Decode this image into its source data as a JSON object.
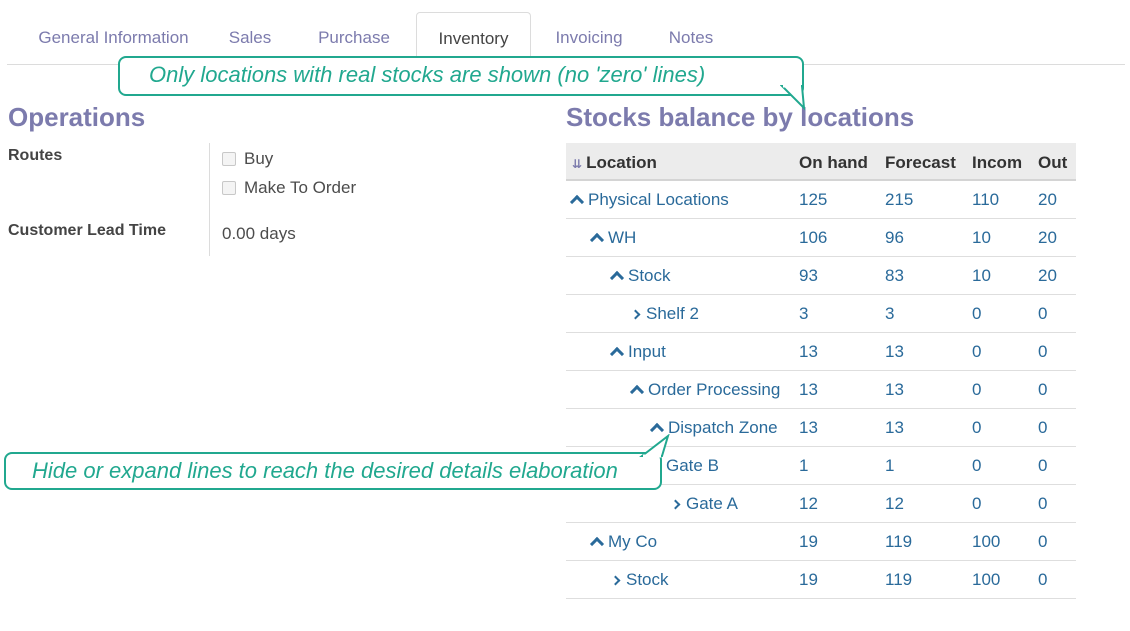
{
  "tabs": [
    {
      "label": "General Information"
    },
    {
      "label": "Sales"
    },
    {
      "label": "Purchase"
    },
    {
      "label": "Inventory"
    },
    {
      "label": "Invoicing"
    },
    {
      "label": "Notes"
    }
  ],
  "operations": {
    "title": "Operations",
    "routes_label": "Routes",
    "routes": [
      {
        "label": "Buy",
        "checked": false
      },
      {
        "label": "Make To Order",
        "checked": false
      }
    ],
    "lead_time_label": "Customer Lead Time",
    "lead_time_value": "0.00 days"
  },
  "stocks": {
    "title": "Stocks balance by locations",
    "columns": [
      "Location",
      "On hand",
      "Forecast",
      "Incom",
      "Out"
    ],
    "rows": [
      {
        "name": "Physical Locations",
        "toggle": "up",
        "on_hand": "125",
        "forecast": "215",
        "incoming": "110",
        "out": "20"
      },
      {
        "name": "WH",
        "toggle": "up",
        "on_hand": "106",
        "forecast": "96",
        "incoming": "10",
        "out": "20"
      },
      {
        "name": "Stock",
        "toggle": "up",
        "on_hand": "93",
        "forecast": "83",
        "incoming": "10",
        "out": "20"
      },
      {
        "name": "Shelf 2",
        "toggle": "right",
        "on_hand": "3",
        "forecast": "3",
        "incoming": "0",
        "out": "0"
      },
      {
        "name": "Input",
        "toggle": "up",
        "on_hand": "13",
        "forecast": "13",
        "incoming": "0",
        "out": "0"
      },
      {
        "name": "Order Processing",
        "toggle": "up",
        "on_hand": "13",
        "forecast": "13",
        "incoming": "0",
        "out": "0"
      },
      {
        "name": "Dispatch Zone",
        "toggle": "up",
        "on_hand": "13",
        "forecast": "13",
        "incoming": "0",
        "out": "0"
      },
      {
        "name": "Gate B",
        "toggle": "right",
        "on_hand": "1",
        "forecast": "1",
        "incoming": "0",
        "out": "0"
      },
      {
        "name": "Gate A",
        "toggle": "right",
        "on_hand": "12",
        "forecast": "12",
        "incoming": "0",
        "out": "0"
      },
      {
        "name": "My Co",
        "toggle": "up",
        "on_hand": "19",
        "forecast": "119",
        "incoming": "100",
        "out": "0"
      },
      {
        "name": "Stock",
        "toggle": "right",
        "on_hand": "19",
        "forecast": "119",
        "incoming": "100",
        "out": "0"
      }
    ]
  },
  "callouts": {
    "top": "Only locations with real stocks are shown (no 'zero' lines)",
    "bottom": "Hide or expand lines to reach the desired details elaboration"
  },
  "colors": {
    "accent": "#7c7bad",
    "link": "#2a6a9a",
    "callout": "#21a88f"
  }
}
